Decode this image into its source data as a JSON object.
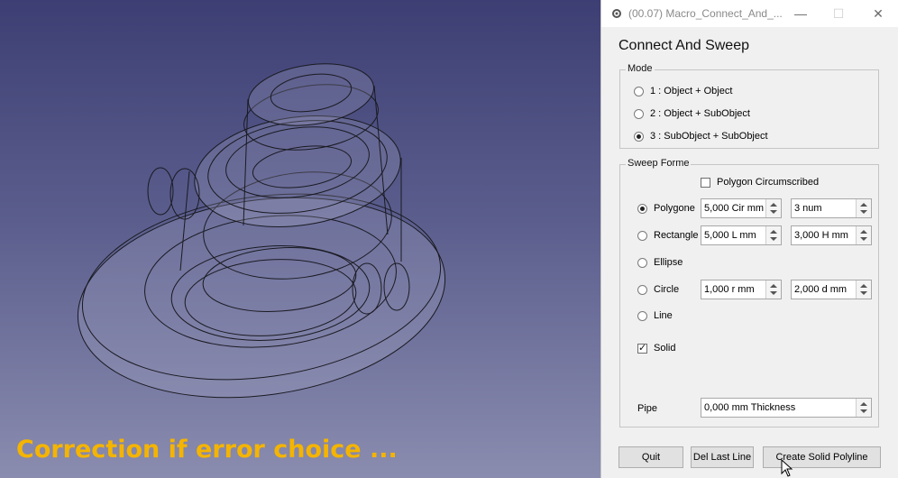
{
  "viewport": {
    "caption": "Correction if error choice ..."
  },
  "window": {
    "title": "(00.07) Macro_Connect_And_...",
    "minimize": "—",
    "maximize": "☐",
    "close": "✕"
  },
  "panel": {
    "heading": "Connect And Sweep",
    "mode": {
      "legend": "Mode",
      "options": [
        "1 : Object + Object",
        "2 : Object + SubObject",
        "3 : SubObject + SubObject"
      ],
      "selected": "3 : SubObject + SubObject"
    },
    "sweep": {
      "legend": "Sweep Forme",
      "polygon_circumscribed": {
        "label": "Polygon Circumscribed",
        "checked": false
      },
      "polygone": {
        "label": "Polygone",
        "selected": true,
        "field1": "5,000 Cir mm",
        "field2": "3 num"
      },
      "rectangle": {
        "label": "Rectangle",
        "selected": false,
        "field1": "5,000 L mm",
        "field2": "3,000 H mm"
      },
      "ellipse": {
        "label": "Ellipse",
        "selected": false
      },
      "circle": {
        "label": "Circle",
        "selected": false,
        "field1": "1,000 r mm",
        "field2": "2,000 d mm"
      },
      "line": {
        "label": "Line",
        "selected": false
      },
      "solid": {
        "label": "Solid",
        "checked": true
      },
      "pipe": {
        "label": "Pipe",
        "value": "0,000 mm Thickness"
      }
    },
    "buttons": {
      "quit": "Quit",
      "del_last_line": "Del Last Line",
      "create": "Create Solid Polyline"
    }
  },
  "colors": {
    "caption": "#f4b400",
    "viewport_top": "#3d3f74",
    "viewport_bottom": "#8a8caf",
    "panel_bg": "#f0f0f0"
  },
  "icons": {
    "app": "freecad-gear-icon",
    "cursor": "mouse-pointer-icon"
  }
}
